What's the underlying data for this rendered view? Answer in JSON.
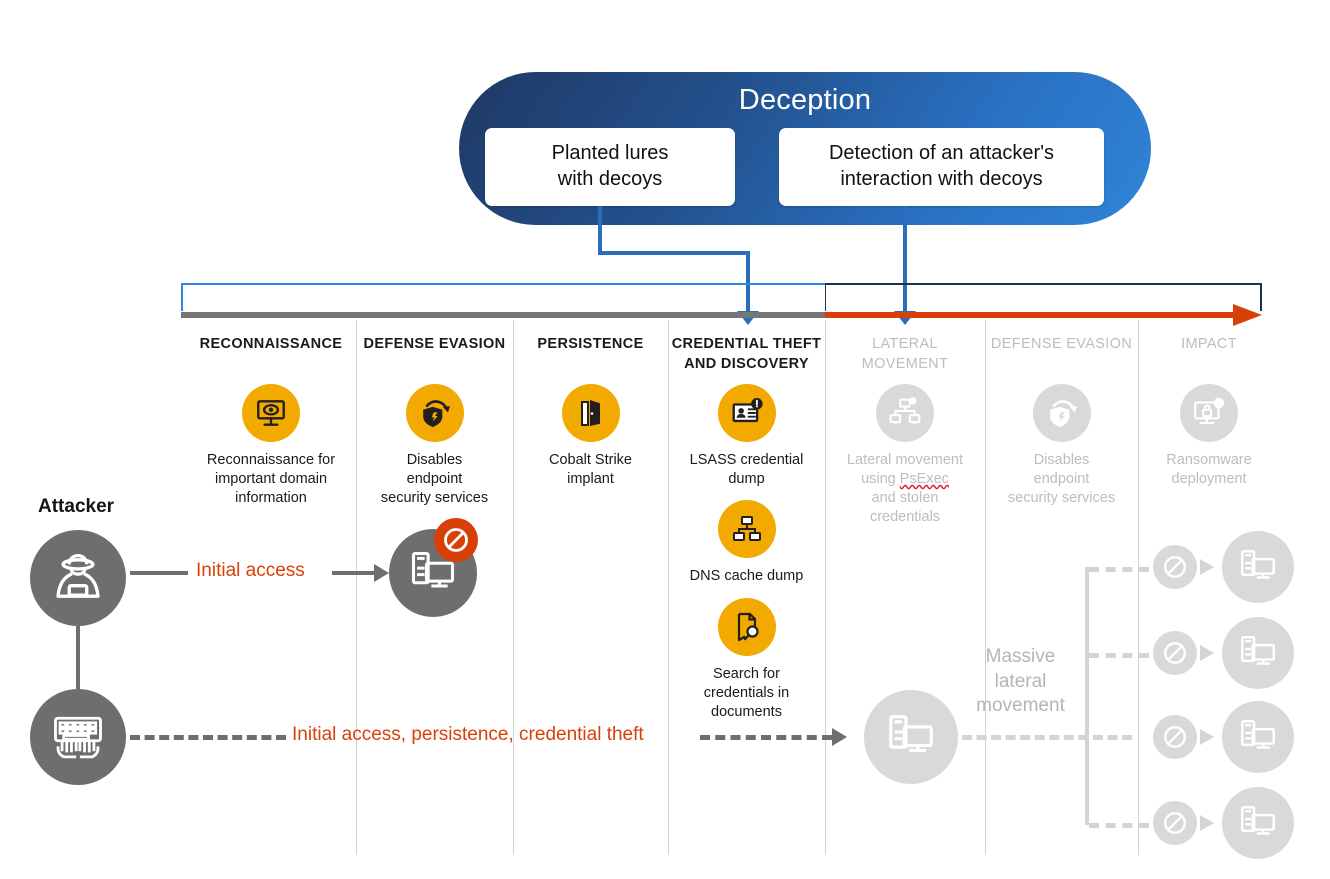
{
  "banner": {
    "title": "Deception",
    "cards": [
      {
        "id": "planted-lures",
        "text": "Planted lures\nwith decoys"
      },
      {
        "id": "detection",
        "text": "Detection of an attacker's\ninteraction with decoys"
      }
    ],
    "color": "#23528f"
  },
  "timeline": {
    "rail_active_color": "#2f87e0",
    "rail_gray_color": "#767676",
    "rail_orange_color": "#d8400a",
    "rail_dark_color": "#1f3050"
  },
  "columns": [
    {
      "id": "reconnaissance",
      "header": "RECONNAISSANCE",
      "dim": false
    },
    {
      "id": "defense-evasion-1",
      "header": "DEFENSE EVASION",
      "dim": false
    },
    {
      "id": "persistence",
      "header": "PERSISTENCE",
      "dim": false
    },
    {
      "id": "credential-theft",
      "header": "CREDENTIAL THEFT\nAND DISCOVERY",
      "dim": false
    },
    {
      "id": "lateral-movement",
      "header": "LATERAL\nMOVEMENT",
      "dim": true
    },
    {
      "id": "defense-evasion-2",
      "header": "DEFENSE EVASION",
      "dim": true
    },
    {
      "id": "impact",
      "header": "IMPACT",
      "dim": true
    }
  ],
  "stages": [
    {
      "id": "recon-item",
      "icon": "monitor-eye-icon",
      "caption": "Reconnaissance for\nimportant domain\ninformation",
      "dim": false
    },
    {
      "id": "defense-evasion-1-item",
      "icon": "shield-bolt-rotate-icon",
      "caption": "Disables\nendpoint\nsecurity services",
      "dim": false
    },
    {
      "id": "persistence-item",
      "icon": "open-door-icon",
      "caption": "Cobalt Strike\nimplant",
      "dim": false
    },
    {
      "id": "lsass-item",
      "icon": "id-badge-alert-icon",
      "caption": "LSASS credential\ndump",
      "dim": false
    },
    {
      "id": "dns-item",
      "icon": "network-nodes-icon",
      "caption": "DNS cache dump",
      "dim": false
    },
    {
      "id": "docsearch-item",
      "icon": "document-search-icon",
      "caption": "Search for\ncredentials in\ndocuments",
      "dim": false
    },
    {
      "id": "lateral-item",
      "icon": "network-devices-alert-icon",
      "caption": "Lateral movement\nusing PsExec\nand stolen\ncredentials",
      "dim": true,
      "misspelled_word": "PsExec"
    },
    {
      "id": "defense-evasion-2-item",
      "icon": "shield-bolt-rotate-icon",
      "caption": "Disables\nendpoint\nsecurity services",
      "dim": true
    },
    {
      "id": "impact-item",
      "icon": "monitor-lock-alert-icon",
      "caption": "Ransomware\ndeployment",
      "dim": true
    }
  ],
  "attacker": {
    "label": "Attacker",
    "actor_icon": "hooded-attacker-icon",
    "keyboard_icon": "hands-on-keyboard-icon"
  },
  "flows": {
    "top_label": "Initial access",
    "bottom_label": "Initial access, persistence, credential theft",
    "label_color": "#d8400a",
    "blocked_badge_icon": "blocked-icon",
    "target_device_icon": "device-icon"
  },
  "lateral": {
    "label": "Massive\nlateral\nmovement",
    "branch_count": 4,
    "branch_blocked_icon": "blocked-icon",
    "branch_device_icon": "device-icon"
  }
}
